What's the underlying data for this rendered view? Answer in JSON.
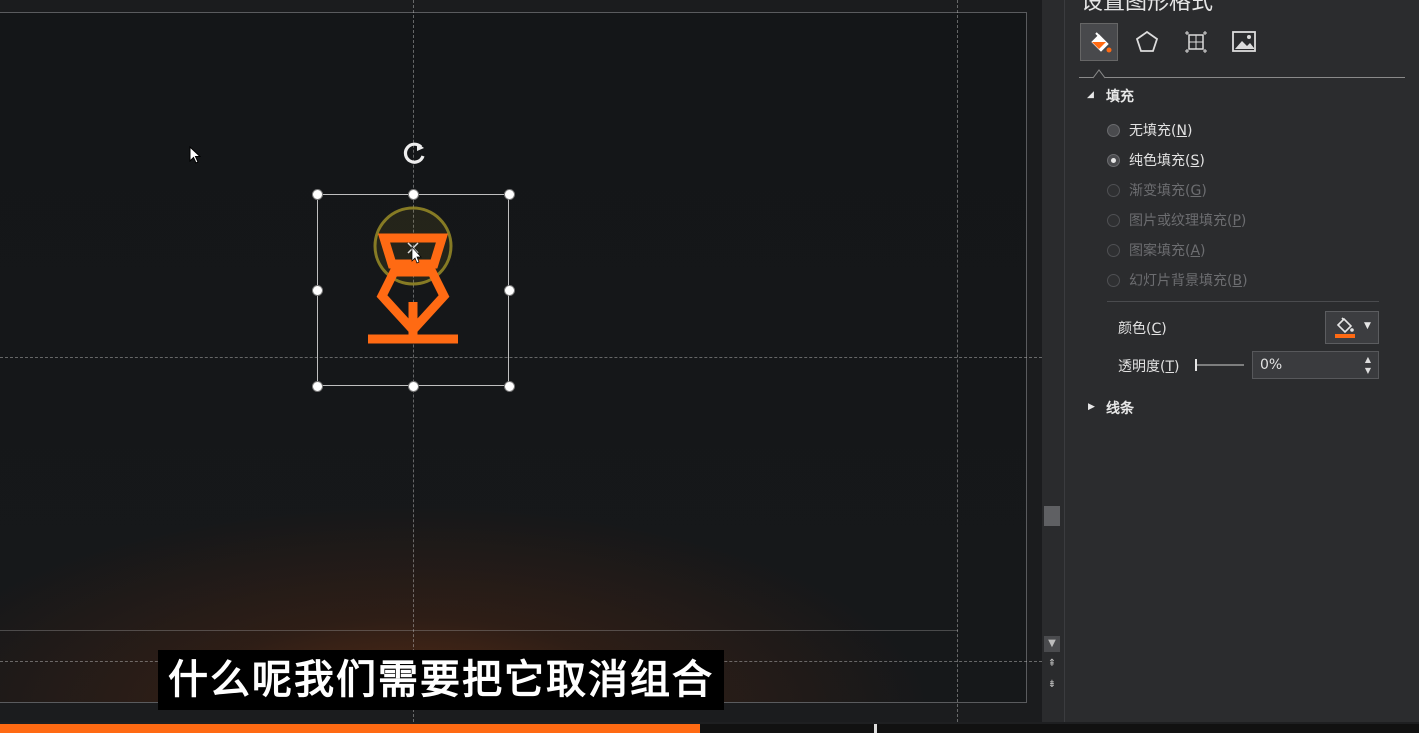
{
  "canvas": {
    "subtitle": "什么呢我们需要把它取消组合"
  },
  "format_pane": {
    "title": "设置图形格式",
    "tabs": [
      {
        "icon": "paint-bucket-icon",
        "active": true
      },
      {
        "icon": "pentagon-icon",
        "active": false
      },
      {
        "icon": "size-layout-icon",
        "active": false
      },
      {
        "icon": "picture-icon",
        "active": false
      }
    ],
    "fill_section": {
      "label": "填充",
      "expanded": true,
      "options": [
        {
          "text": "无填充",
          "key": "N",
          "enabled": true,
          "selected": false
        },
        {
          "text": "纯色填充",
          "key": "S",
          "enabled": true,
          "selected": true
        },
        {
          "text": "渐变填充",
          "key": "G",
          "enabled": false,
          "selected": false
        },
        {
          "text": "图片或纹理填充",
          "key": "P",
          "enabled": false,
          "selected": false
        },
        {
          "text": "图案填充",
          "key": "A",
          "enabled": false,
          "selected": false
        },
        {
          "text": "幻灯片背景填充",
          "key": "B",
          "enabled": false,
          "selected": false
        }
      ],
      "color_label": "颜色",
      "color_key": "C",
      "color_value": "#ff6a13",
      "transparency_label": "透明度",
      "transparency_key": "T",
      "transparency_value": "0%"
    },
    "line_section": {
      "label": "线条",
      "expanded": false
    }
  },
  "progress": {
    "fraction": 0.493
  },
  "colors": {
    "accent": "#ff6a13",
    "subtitle_bg": "#000000"
  }
}
